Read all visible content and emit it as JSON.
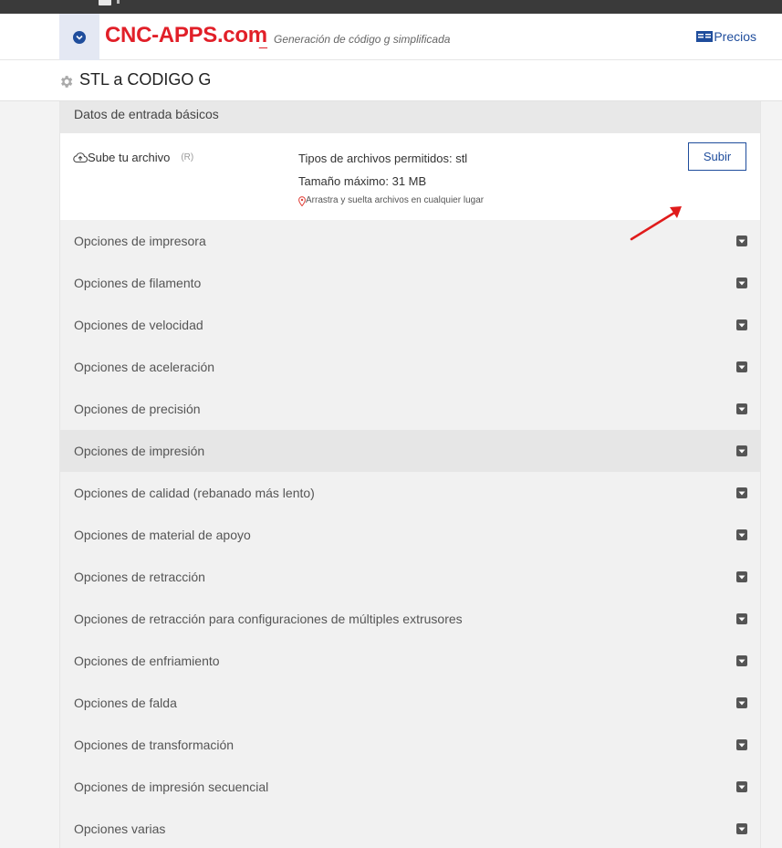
{
  "header": {
    "brand": "CNC-APPS.com",
    "brand_separator": "_",
    "tagline": "Generación de código g simplificada",
    "pricing_label": "Precios"
  },
  "page": {
    "title": "STL a CODIGO G"
  },
  "basic_section": {
    "title": "Datos de entrada básicos",
    "upload_label": "Sube tu archivo",
    "required_marker": "(R)",
    "allowed_types": "Tipos de archivos permitidos: stl",
    "max_size": "Tamaño máximo: 31 MB",
    "drag_hint": "Arrastra y suelta archivos en cualquier lugar",
    "upload_button": "Subir"
  },
  "options": [
    {
      "label": "Opciones de impresora"
    },
    {
      "label": "Opciones de filamento"
    },
    {
      "label": "Opciones de velocidad"
    },
    {
      "label": "Opciones de aceleración"
    },
    {
      "label": "Opciones de precisión"
    },
    {
      "label": "Opciones de impresión",
      "highlighted": true
    },
    {
      "label": "Opciones de calidad (rebanado más lento)"
    },
    {
      "label": "Opciones de material de apoyo"
    },
    {
      "label": "Opciones de retracción"
    },
    {
      "label": "Opciones de retracción para configuraciones de múltiples extrusores"
    },
    {
      "label": "Opciones de enfriamiento"
    },
    {
      "label": "Opciones de falda"
    },
    {
      "label": "Opciones de transformación"
    },
    {
      "label": "Opciones de impresión secuencial"
    },
    {
      "label": "Opciones varias"
    }
  ],
  "colors": {
    "brand": "#e11f28",
    "accent": "#1f4d9c",
    "annotation_arrow": "#e01b1b"
  },
  "icons": {
    "menu": "chevron-down-circle-icon",
    "pricing": "price-list-icon",
    "title": "gear-icon",
    "upload": "cloud-upload-icon",
    "drag": "map-pin-icon",
    "option_toggle": "caret-square-down-icon"
  }
}
